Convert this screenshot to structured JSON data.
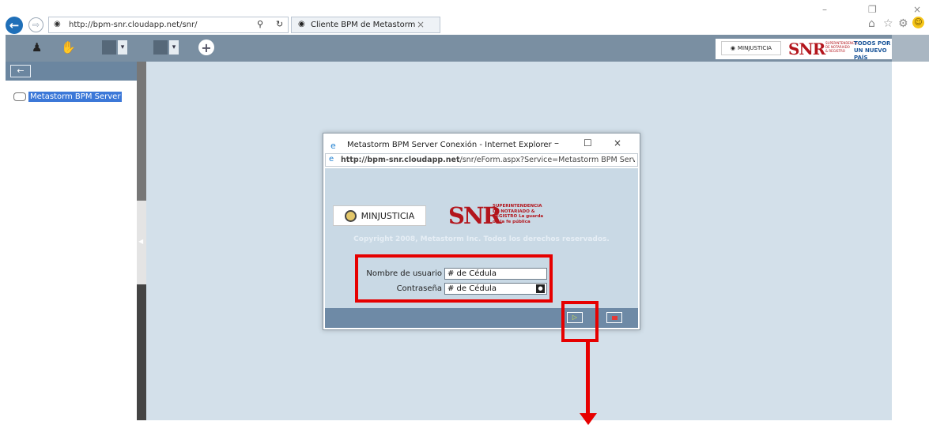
{
  "browser": {
    "address": "http://bpm-snr.cloudapp.net/snr/",
    "tab_title": "Cliente BPM de Metastorm",
    "window_controls": {
      "minimize": "–",
      "restore": "❐",
      "close": "×"
    }
  },
  "header": {
    "minjusticia_label": "MINJUSTICIA",
    "snr_mark": "SNR",
    "snr_subtitle": "SUPERINTENDENCIA DE NOTARIADO & REGISTRO",
    "todos_label": "TODOS POR UN NUEVO PAÍS"
  },
  "sidebar": {
    "items": [
      {
        "label": "Metastorm BPM Server"
      }
    ]
  },
  "dialog": {
    "title": "Metastorm BPM Server Conexión - Internet Explorer",
    "url_host": "http://bpm-snr.cloudapp.net",
    "url_path": "/snr/eForm.aspx?Service=Metastorm BPM Server&Typ",
    "minjusticia_label": "MINJUSTICIA",
    "snr_mark": "SNR",
    "snr_subtitle": "SUPERINTENDENCIA DE NOTARIADO & REGISTRO La guarda de la fe pública",
    "copyright": "Copyright 2008, Metastorm Inc. Todos los derechos reservados.",
    "username_label": "Nombre de usuario",
    "username_value": "# de Cédula",
    "password_label": "Contraseña",
    "password_value": "# de Cédula"
  },
  "colors": {
    "toolbar": "#7a8fa2",
    "workspace": "#d3e0ea",
    "annotation": "#e60000",
    "snr_red": "#b3151c"
  },
  "icons": [
    "back-arrow-icon",
    "forward-arrow-icon",
    "search-icon",
    "refresh-icon",
    "home-icon",
    "star-icon",
    "gear-icon",
    "smiley-icon",
    "user-icon",
    "handshake-icon",
    "briefcase-icon",
    "plus-icon",
    "collapse-icon",
    "folder-icon",
    "play-icon",
    "stop-icon",
    "eye-icon"
  ]
}
